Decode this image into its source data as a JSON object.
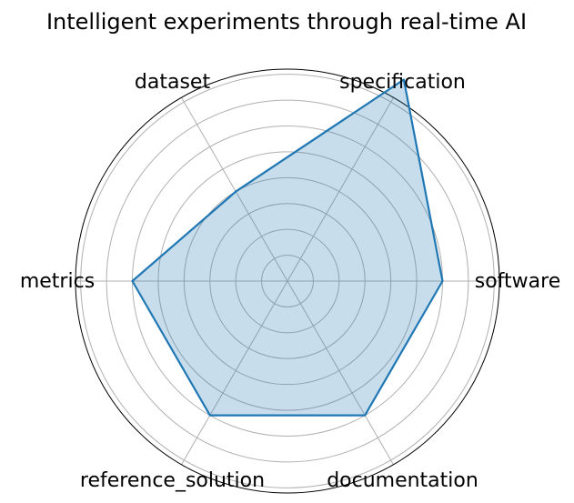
{
  "chart_data": {
    "type": "radar",
    "title": "Intelligent experiments through real-time AI",
    "categories": [
      "software",
      "specification",
      "dataset",
      "metrics",
      "reference_solution",
      "documentation"
    ],
    "values": [
      0.6,
      0.9,
      0.4,
      0.6,
      0.6,
      0.6
    ],
    "rlim": [
      0,
      0.82
    ],
    "grid": true,
    "grid_rings": [
      0.1,
      0.2,
      0.3,
      0.4,
      0.5,
      0.6,
      0.7,
      0.8
    ],
    "colors": {
      "line": "#1f77b4",
      "fill": "#1f77b4",
      "grid": "#b0b0b0",
      "frame": "#000000"
    }
  }
}
